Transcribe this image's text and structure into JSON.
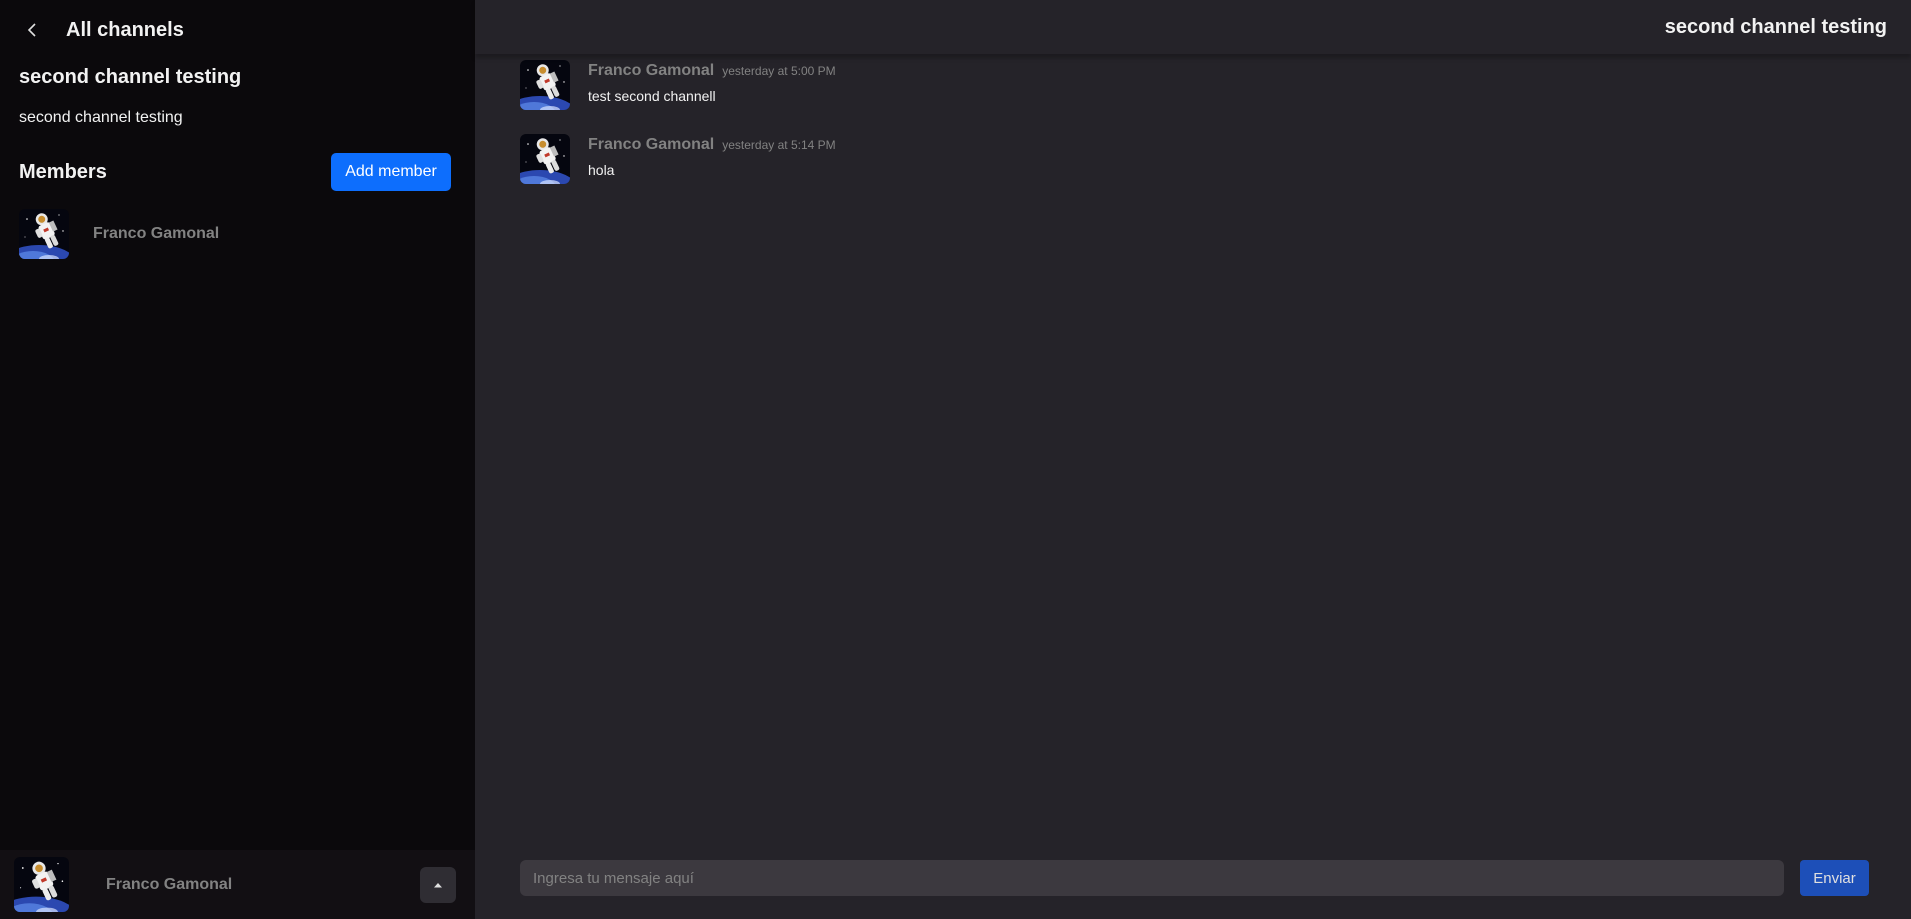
{
  "sidebar": {
    "header": {
      "back_icon": "chevron-left-icon",
      "title": "All channels"
    },
    "channel": {
      "name": "second channel testing",
      "description": "second channel testing"
    },
    "members": {
      "title": "Members",
      "add_button": "Add member",
      "items": [
        {
          "name": "Franco Gamonal",
          "avatar": "astronaut-avatar"
        }
      ]
    },
    "footer": {
      "user_name": "Franco Gamonal",
      "menu_icon": "caret-up-icon"
    }
  },
  "main": {
    "channel_title": "second channel testing",
    "messages": [
      {
        "author": "Franco Gamonal",
        "time": "yesterday at 5:00 PM",
        "text": "test second channell"
      },
      {
        "author": "Franco Gamonal",
        "time": "yesterday at 5:14 PM",
        "text": "hola"
      }
    ],
    "composer": {
      "placeholder": "Ingresa tu mensaje aquí",
      "send_label": "Enviar"
    }
  },
  "colors": {
    "sidebar_bg": "#0b090c",
    "main_bg": "#252329",
    "accent": "#0d6efd",
    "send_button": "#1d4fb8",
    "muted_text": "#828282"
  }
}
